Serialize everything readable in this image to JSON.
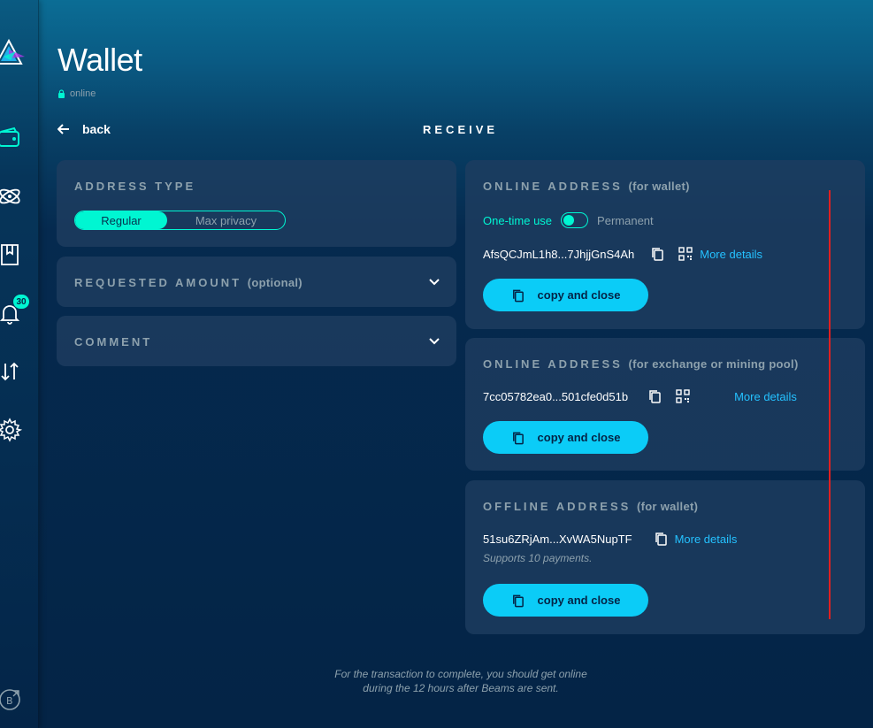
{
  "header": {
    "title": "Wallet",
    "status": "online",
    "back_label": "back",
    "section_title": "RECEIVE"
  },
  "sidebar": {
    "items": [
      {
        "icon": "wallet-icon"
      },
      {
        "icon": "atom-icon"
      },
      {
        "icon": "book-icon"
      },
      {
        "icon": "bell-icon",
        "badge": "30"
      },
      {
        "icon": "transfer-icon"
      },
      {
        "icon": "gear-icon"
      },
      {
        "icon": "beam-external-icon"
      }
    ]
  },
  "left": {
    "address_type": {
      "label": "ADDRESS TYPE",
      "options": [
        "Regular",
        "Max privacy"
      ],
      "selected": "Regular"
    },
    "requested_amount": {
      "label": "REQUESTED AMOUNT",
      "sub": "(optional)"
    },
    "comment": {
      "label": "COMMENT"
    }
  },
  "cards": {
    "online_wallet": {
      "label": "ONLINE ADDRESS",
      "sub": "(for wallet)",
      "toggle_left": "One-time use",
      "toggle_right": "Permanent",
      "address": "AfsQCJmL1h8...7JhjjGnS4Ah",
      "more": "More details",
      "button": "copy and close"
    },
    "online_exchange": {
      "label": "ONLINE ADDRESS",
      "sub": "(for exchange or mining pool)",
      "address": "7cc05782ea0...501cfe0d51b",
      "more": "More details",
      "button": "copy and close"
    },
    "offline_wallet": {
      "label": "OFFLINE ADDRESS",
      "sub": "(for wallet)",
      "address": "51su6ZRjAm...XvWA5NupTF",
      "more": "More details",
      "note": "Supports 10 payments.",
      "button": "copy and close"
    }
  },
  "footer": {
    "line1": "For the transaction to complete, you should get online",
    "line2": "during the 12 hours after Beams are sent."
  },
  "colors": {
    "accent": "#00f6d2",
    "button": "#0bccf7",
    "link": "#24c1ff",
    "panel": "#1f3d60",
    "muted": "#8da1ad"
  }
}
